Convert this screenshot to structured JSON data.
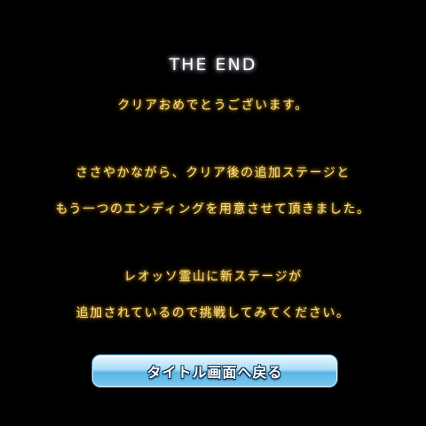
{
  "ending": {
    "title": "THE END",
    "lines": [
      "クリアおめでとうございます。",
      "ささやかながら、クリア後の追加ステージと",
      "もう一つのエンディングを用意させて頂きました。",
      "レオッソ霊山に新ステージが",
      "追加されているので挑戦してみてください。"
    ]
  },
  "back_button": {
    "label": "タイトル画面へ戻る"
  },
  "colors": {
    "background": "#000000",
    "title": "#ffffff",
    "message": "#ffe27a",
    "button_top": "#e9f7ff",
    "button_bottom": "#58b6e8"
  }
}
